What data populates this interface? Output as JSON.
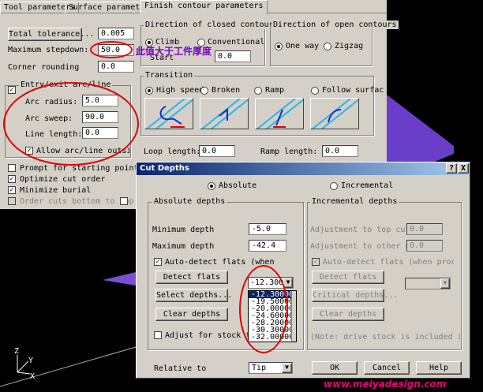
{
  "tabs": [
    "Tool parameters",
    "Surface parameters",
    "Finish contour parameters"
  ],
  "left": {
    "total_tolerance_btn": "Total tolerance...",
    "total_tolerance_val": "0.005",
    "max_stepdown_label": "Maximum stepdown:",
    "max_stepdown_val": "50.0",
    "corner_rounding_label": "Corner rounding",
    "corner_rounding_val": "0.0",
    "entry_exit_label": "Entry/exit arc/line",
    "arc_radius_label": "Arc radius:",
    "arc_radius_val": "5.0",
    "arc_sweep_label": "Arc sweep:",
    "arc_sweep_val": "90.0",
    "line_length_label": "Line length:",
    "line_length_val": "0.0",
    "allow_outside_label": "Allow arc/line outside bo",
    "prompt_start_label": "Prompt for starting point",
    "optimize_label": "Optimize cut order",
    "min_burial_label": "Minimize burial",
    "order_cuts_label": "Order cuts bottom to top"
  },
  "annotation": "此值大于工件厚度",
  "closed": {
    "title": "Direction of closed contours",
    "climb": "Climb",
    "conventional": "Conventional",
    "start_label": "Start",
    "start_val": "0.0"
  },
  "open": {
    "title": "Direction of open contours",
    "one_way": "One way",
    "zigzag": "Zigzag"
  },
  "transition": {
    "title": "Transition",
    "options": [
      "High speed",
      "Broken",
      "Ramp",
      "Follow surfac"
    ],
    "loop_length_label": "Loop length:",
    "loop_length_val": "0.0",
    "ramp_length_label": "Ramp length:",
    "ramp_length_val": "0.0"
  },
  "cut": {
    "title": "Cut Depths",
    "help_btn": "?",
    "close_btn": "X",
    "absolute": "Absolute",
    "incremental": "Incremental",
    "abs_group": "Absolute depths",
    "min_depth_label": "Minimum depth",
    "min_depth_val": "-5.0",
    "max_depth_label": "Maximum depth",
    "max_depth_val": "-42.4",
    "auto_detect_label": "Auto-detect flats (when proce",
    "detect_flats": "Detect flats",
    "select_depths": "Select depths...",
    "clear_depths": "Clear depths",
    "adjust_stock": "Adjust for stock to le",
    "combo_val": "-12.30000",
    "depth_list": [
      "-12.30000",
      "-19.50000",
      "-20.00000",
      "-24.60000",
      "-28.20000",
      "-30.30000",
      "-32.00000"
    ],
    "inc_group": "Incremental depths",
    "adj_top_label": "Adjustment to top cut",
    "adj_top_val": "0.0",
    "adj_other_label": "Adjustment to other cuts",
    "adj_other_val": "0.0",
    "inc_auto_detect": "Auto-detect flats (when proce",
    "inc_detect": "Detect flats",
    "critical": "Critical depths...",
    "inc_clear": "Clear depths",
    "note": "(Note: drive stock is included in",
    "relative_label": "Relative to",
    "relative_val": "Tip",
    "ok": "OK",
    "cancel": "Cancel",
    "help": "Help"
  },
  "axis": {
    "z": "Z",
    "y": "Y",
    "x": "X"
  },
  "watermark": "www.meiyadesign.com"
}
